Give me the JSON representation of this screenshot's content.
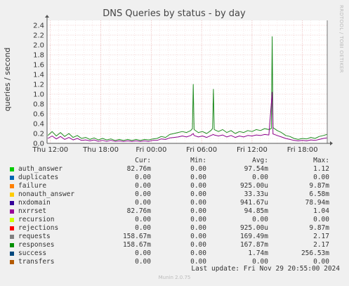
{
  "chart_data": {
    "type": "line",
    "title": "DNS Queries by status - by day",
    "ylabel": "queries / second",
    "ylim": [
      0,
      2.5
    ],
    "yticks": [
      "0.0",
      "0.2",
      "0.4",
      "0.6",
      "0.8",
      "1.0",
      "1.2",
      "1.4",
      "1.6",
      "1.8",
      "2.0",
      "2.2",
      "2.4"
    ],
    "xticks": [
      {
        "label": "Thu 12:00",
        "hours": 0
      },
      {
        "label": "Thu 18:00",
        "hours": 6
      },
      {
        "label": "Fri 00:00",
        "hours": 12
      },
      {
        "label": "Fri 06:00",
        "hours": 18
      },
      {
        "label": "Fri 12:00",
        "hours": 24
      },
      {
        "label": "Fri 18:00",
        "hours": 30
      }
    ],
    "x_range_hours": [
      -0.4,
      32.95
    ],
    "grid": true,
    "series": [
      {
        "name": "responses",
        "color": "#1e8b1e",
        "points": [
          [
            -0.3,
            0.16
          ],
          [
            0.2,
            0.24
          ],
          [
            0.7,
            0.15
          ],
          [
            1.2,
            0.22
          ],
          [
            1.7,
            0.14
          ],
          [
            2.2,
            0.2
          ],
          [
            2.7,
            0.12
          ],
          [
            3.2,
            0.16
          ],
          [
            3.7,
            0.1
          ],
          [
            4.2,
            0.12
          ],
          [
            4.7,
            0.08
          ],
          [
            5.2,
            0.11
          ],
          [
            5.7,
            0.07
          ],
          [
            6.2,
            0.1
          ],
          [
            6.7,
            0.07
          ],
          [
            7.2,
            0.09
          ],
          [
            7.7,
            0.06
          ],
          [
            8.2,
            0.08
          ],
          [
            8.7,
            0.06
          ],
          [
            9.2,
            0.08
          ],
          [
            9.7,
            0.06
          ],
          [
            10.2,
            0.08
          ],
          [
            10.7,
            0.06
          ],
          [
            11.2,
            0.08
          ],
          [
            11.7,
            0.07
          ],
          [
            12.2,
            0.09
          ],
          [
            12.7,
            0.1
          ],
          [
            13.2,
            0.14
          ],
          [
            13.7,
            0.12
          ],
          [
            14.2,
            0.18
          ],
          [
            14.7,
            0.2
          ],
          [
            15.2,
            0.22
          ],
          [
            15.7,
            0.24
          ],
          [
            16.2,
            0.22
          ],
          [
            16.7,
            0.26
          ],
          [
            16.9,
            0.3
          ],
          [
            17.0,
            1.2
          ],
          [
            17.1,
            0.28
          ],
          [
            17.6,
            0.22
          ],
          [
            18.1,
            0.24
          ],
          [
            18.6,
            0.2
          ],
          [
            19.1,
            0.26
          ],
          [
            19.3,
            0.3
          ],
          [
            19.4,
            1.1
          ],
          [
            19.5,
            0.28
          ],
          [
            20.0,
            0.24
          ],
          [
            20.5,
            0.28
          ],
          [
            21.0,
            0.22
          ],
          [
            21.5,
            0.26
          ],
          [
            22.0,
            0.2
          ],
          [
            22.5,
            0.24
          ],
          [
            23.0,
            0.22
          ],
          [
            23.5,
            0.26
          ],
          [
            24.0,
            0.24
          ],
          [
            24.5,
            0.28
          ],
          [
            25.0,
            0.26
          ],
          [
            25.5,
            0.3
          ],
          [
            26.0,
            0.28
          ],
          [
            26.3,
            0.3
          ],
          [
            26.4,
            2.17
          ],
          [
            26.5,
            0.32
          ],
          [
            27.0,
            0.26
          ],
          [
            27.5,
            0.22
          ],
          [
            28.0,
            0.16
          ],
          [
            28.5,
            0.14
          ],
          [
            29.0,
            0.1
          ],
          [
            29.5,
            0.08
          ],
          [
            30.0,
            0.1
          ],
          [
            30.5,
            0.09
          ],
          [
            31.0,
            0.12
          ],
          [
            31.5,
            0.1
          ],
          [
            32.0,
            0.14
          ],
          [
            32.5,
            0.16
          ],
          [
            32.9,
            0.18
          ]
        ]
      },
      {
        "name": "nxrrset",
        "color": "#8b008b",
        "points": [
          [
            -0.3,
            0.1
          ],
          [
            0.2,
            0.15
          ],
          [
            0.7,
            0.09
          ],
          [
            1.2,
            0.14
          ],
          [
            1.7,
            0.08
          ],
          [
            2.2,
            0.12
          ],
          [
            2.7,
            0.07
          ],
          [
            3.2,
            0.1
          ],
          [
            3.7,
            0.06
          ],
          [
            4.2,
            0.07
          ],
          [
            4.7,
            0.05
          ],
          [
            5.2,
            0.07
          ],
          [
            5.7,
            0.04
          ],
          [
            6.2,
            0.06
          ],
          [
            6.7,
            0.04
          ],
          [
            7.2,
            0.06
          ],
          [
            7.7,
            0.04
          ],
          [
            8.2,
            0.05
          ],
          [
            8.7,
            0.04
          ],
          [
            9.2,
            0.05
          ],
          [
            9.7,
            0.04
          ],
          [
            10.2,
            0.05
          ],
          [
            10.7,
            0.04
          ],
          [
            11.2,
            0.05
          ],
          [
            11.7,
            0.04
          ],
          [
            12.2,
            0.06
          ],
          [
            12.7,
            0.06
          ],
          [
            13.2,
            0.09
          ],
          [
            13.7,
            0.08
          ],
          [
            14.2,
            0.11
          ],
          [
            14.7,
            0.12
          ],
          [
            15.2,
            0.13
          ],
          [
            15.7,
            0.15
          ],
          [
            16.2,
            0.13
          ],
          [
            16.7,
            0.16
          ],
          [
            17.0,
            0.2
          ],
          [
            17.1,
            0.16
          ],
          [
            17.6,
            0.13
          ],
          [
            18.1,
            0.15
          ],
          [
            18.6,
            0.12
          ],
          [
            19.1,
            0.16
          ],
          [
            19.4,
            0.18
          ],
          [
            19.5,
            0.17
          ],
          [
            20.0,
            0.15
          ],
          [
            20.5,
            0.17
          ],
          [
            21.0,
            0.13
          ],
          [
            21.5,
            0.16
          ],
          [
            22.0,
            0.12
          ],
          [
            22.5,
            0.15
          ],
          [
            23.0,
            0.13
          ],
          [
            23.5,
            0.16
          ],
          [
            24.0,
            0.15
          ],
          [
            24.5,
            0.17
          ],
          [
            25.0,
            0.16
          ],
          [
            25.5,
            0.18
          ],
          [
            26.0,
            0.17
          ],
          [
            26.4,
            1.04
          ],
          [
            26.5,
            0.19
          ],
          [
            27.0,
            0.16
          ],
          [
            27.5,
            0.13
          ],
          [
            28.0,
            0.1
          ],
          [
            28.5,
            0.08
          ],
          [
            29.0,
            0.06
          ],
          [
            29.5,
            0.05
          ],
          [
            30.0,
            0.06
          ],
          [
            30.5,
            0.05
          ],
          [
            31.0,
            0.07
          ],
          [
            31.5,
            0.06
          ],
          [
            32.0,
            0.08
          ],
          [
            32.5,
            0.1
          ],
          [
            32.9,
            0.11
          ]
        ]
      }
    ]
  },
  "side_text": "RRDTOOL / TOBI OETIKER",
  "legend": {
    "headers": {
      "cur": "Cur:",
      "min": "Min:",
      "avg": "Avg:",
      "max": "Max:"
    },
    "rows": [
      {
        "name": "auth_answer",
        "color": "#00cc00",
        "cur": "82.76m",
        "min": "0.00",
        "avg": "97.54m",
        "max": "1.12"
      },
      {
        "name": "duplicates",
        "color": "#0066b3",
        "cur": "0.00",
        "min": "0.00",
        "avg": "0.00",
        "max": "0.00"
      },
      {
        "name": "failure",
        "color": "#ff8000",
        "cur": "0.00",
        "min": "0.00",
        "avg": "925.00u",
        "max": "9.87m"
      },
      {
        "name": "nonauth_answer",
        "color": "#ffcc00",
        "cur": "0.00",
        "min": "0.00",
        "avg": "33.33u",
        "max": "6.58m"
      },
      {
        "name": "nxdomain",
        "color": "#330099",
        "cur": "0.00",
        "min": "0.00",
        "avg": "941.67u",
        "max": "78.94m"
      },
      {
        "name": "nxrrset",
        "color": "#990099",
        "cur": "82.76m",
        "min": "0.00",
        "avg": "94.85m",
        "max": "1.04"
      },
      {
        "name": "recursion",
        "color": "#ccff00",
        "cur": "0.00",
        "min": "0.00",
        "avg": "0.00",
        "max": "0.00"
      },
      {
        "name": "rejections",
        "color": "#ff0000",
        "cur": "0.00",
        "min": "0.00",
        "avg": "925.00u",
        "max": "9.87m"
      },
      {
        "name": "requests",
        "color": "#808080",
        "cur": "158.67m",
        "min": "0.00",
        "avg": "169.49m",
        "max": "2.17"
      },
      {
        "name": "responses",
        "color": "#008f00",
        "cur": "158.67m",
        "min": "0.00",
        "avg": "167.87m",
        "max": "2.17"
      },
      {
        "name": "success",
        "color": "#00487d",
        "cur": "0.00",
        "min": "0.00",
        "avg": "1.74m",
        "max": "256.53m"
      },
      {
        "name": "transfers",
        "color": "#b35a00",
        "cur": "0.00",
        "min": "0.00",
        "avg": "0.00",
        "max": "0.00"
      }
    ]
  },
  "last_update": "Last update: Fri Nov 29 20:55:00 2024",
  "footer": "Munin 2.0.75"
}
